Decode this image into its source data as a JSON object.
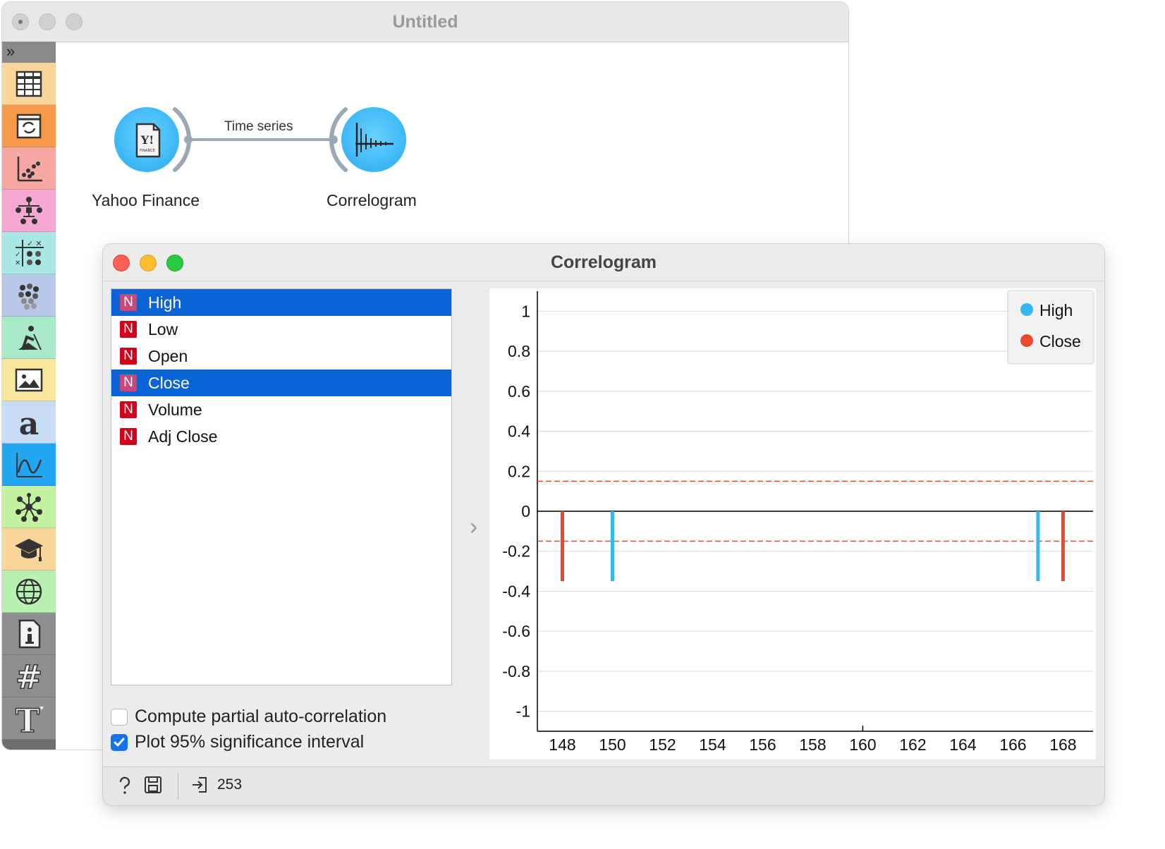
{
  "main_window": {
    "title": "Untitled",
    "toolbox": {
      "collapse_glyph": "»",
      "categories": [
        {
          "icon": "data-table-icon",
          "color": "#f9d49b"
        },
        {
          "icon": "transform-icon",
          "color": "#f79a4a"
        },
        {
          "icon": "visualize-icon",
          "color": "#f7a7a2"
        },
        {
          "icon": "model-tree-icon",
          "color": "#f5a8d2"
        },
        {
          "icon": "evaluate-icon",
          "color": "#a9e7e6"
        },
        {
          "icon": "unsupervised-icon",
          "color": "#b9c8e8"
        },
        {
          "icon": "prototypes-icon",
          "color": "#a9e8c8"
        },
        {
          "icon": "image-analytics-icon",
          "color": "#f9e79b"
        },
        {
          "icon": "text-mining-icon",
          "color": "#c7dcf5"
        },
        {
          "icon": "timeseries-icon",
          "color": "#23a6f2"
        },
        {
          "icon": "network-icon",
          "color": "#c3f2a0"
        },
        {
          "icon": "educational-icon",
          "color": "#f9d49b"
        },
        {
          "icon": "geo-icon",
          "color": "#b7f0b1"
        },
        {
          "icon": "info-icon",
          "color": "#8f8f8f"
        },
        {
          "icon": "hash-icon",
          "color": "#8f8f8f"
        },
        {
          "icon": "text-tool-icon",
          "color": "#8f8f8f"
        }
      ]
    },
    "canvas": {
      "nodes": [
        {
          "label": "Yahoo Finance",
          "icon": "yahoo-finance-icon"
        },
        {
          "label": "Correlogram",
          "icon": "correlogram-icon"
        }
      ],
      "link_label": "Time series"
    }
  },
  "correlogram_window": {
    "title": "Correlogram",
    "variables": [
      {
        "badge": "N",
        "name": "High",
        "selected": true
      },
      {
        "badge": "N",
        "name": "Low",
        "selected": false
      },
      {
        "badge": "N",
        "name": "Open",
        "selected": false
      },
      {
        "badge": "N",
        "name": "Close",
        "selected": true
      },
      {
        "badge": "N",
        "name": "Volume",
        "selected": false
      },
      {
        "badge": "N",
        "name": "Adj Close",
        "selected": false
      }
    ],
    "options": {
      "partial_label": "Compute partial auto-correlation",
      "partial_checked": false,
      "significance_label": "Plot 95% significance interval",
      "significance_checked": true
    },
    "status_bar": {
      "help_icon": "help-icon",
      "save_icon": "save-icon",
      "input_icon": "input-icon",
      "input_count": "253"
    }
  },
  "chart_data": {
    "type": "bar",
    "x_ticks": [
      148,
      150,
      152,
      154,
      156,
      158,
      160,
      162,
      164,
      166,
      168
    ],
    "y_ticks": [
      "1",
      "0.8",
      "0.6",
      "0.4",
      "0.2",
      "0",
      "-0.2",
      "-0.4",
      "-0.6",
      "-0.8",
      "-1"
    ],
    "xlim": [
      147,
      169.2
    ],
    "ylim": [
      -1.1,
      1.1
    ],
    "grid": true,
    "legend_position": "top-right",
    "significance_interval": [
      -0.15,
      0.15
    ],
    "series": [
      {
        "name": "High",
        "color": "#35b8f2",
        "points": [
          {
            "x": 150,
            "y": -0.35
          },
          {
            "x": 167,
            "y": -0.35
          }
        ]
      },
      {
        "name": "Close",
        "color": "#e8492f",
        "points": [
          {
            "x": 148,
            "y": -0.35
          },
          {
            "x": 168,
            "y": -0.35
          }
        ]
      }
    ],
    "significance_color": "#e8492f"
  }
}
